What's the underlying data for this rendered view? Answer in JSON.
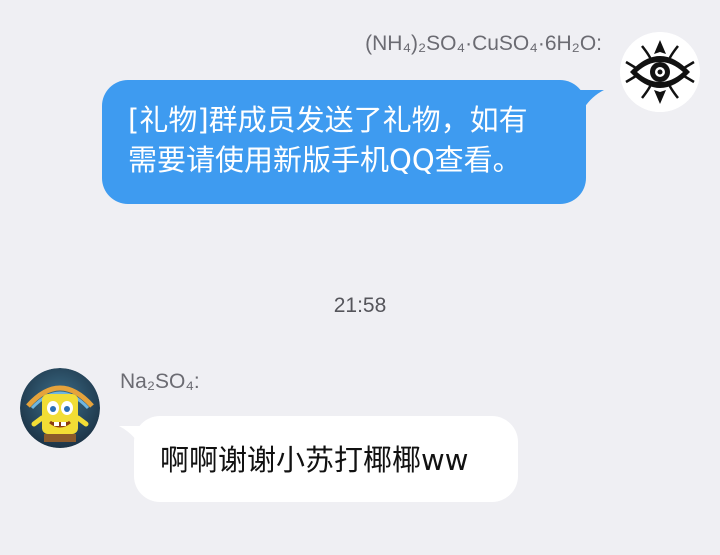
{
  "chat": {
    "messages": [
      {
        "sender": "(NH₄)₂SO₄·CuSO₄·6H₂O:",
        "text": "[礼物]群成员发送了礼物，如有需要请使用新版手机QQ查看。",
        "text_line1": "[礼物]群成员发送了礼物，如有",
        "text_line2": "需要请使用新版手机QQ查看。",
        "side": "right",
        "bubble_color": "#3e9bf0"
      },
      {
        "sender": "Na₂SO₄:",
        "text": "啊啊谢谢小苏打椰椰ww",
        "side": "left",
        "bubble_color": "#ffffff"
      }
    ],
    "timestamp": "21:58"
  },
  "icons": {
    "right_avatar": "emblem-avatar-icon",
    "left_avatar": "cartoon-avatar-icon"
  },
  "colors": {
    "background": "#efeff3",
    "accent": "#3e9bf0"
  }
}
